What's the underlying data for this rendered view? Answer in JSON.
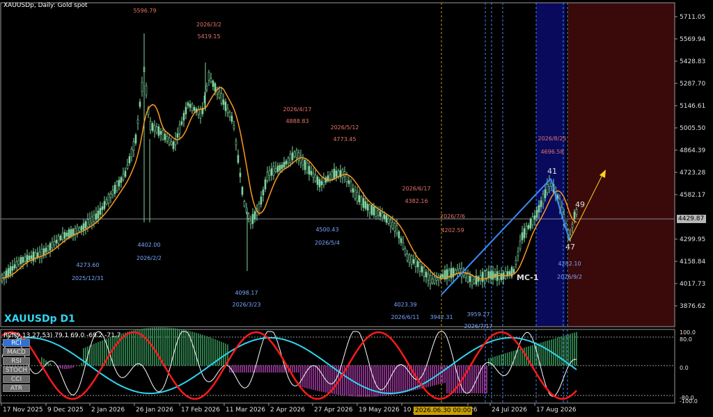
{
  "header": {
    "title": "XAUUSDp, Daily:  Gold spot"
  },
  "symbol_label": "XAUUSDp D1",
  "colors": {
    "background": "#000000",
    "bull": "#7fd6a0",
    "ma": "#ff9a1f",
    "annotation_high": "#e8756a",
    "annotation_low": "#7aa7ff",
    "trend": "#3a8dff",
    "projection": "#ffd21a",
    "zone_blue": "#0a0a5c",
    "zone_red": "#3a0a0a",
    "rci_fast": "#ffffff",
    "rci_mid": "#ff1a1a",
    "rci_slow": "#2fd6f0"
  },
  "price_axis": [
    "5711.05",
    "5569.94",
    "5428.83",
    "5287.70",
    "5146.61",
    "5005.50",
    "4864.39",
    "4723.28",
    "4582.17",
    "4429.87",
    "4299.95",
    "4158.84",
    "4017.73",
    "3876.62"
  ],
  "current_price": "4429.87",
  "date_axis": [
    "17 Nov 2025",
    "9 Dec 2025",
    "2 Jan 2026",
    "26 Jan 2026",
    "17 Feb 2026",
    "11 Mar 2026",
    "2 Apr 2026",
    "27 Apr 2026",
    "19 May 2026",
    "10 J",
    "26",
    "24 Jul 2026",
    "17 Aug 2026"
  ],
  "cursor_time": "2026.06.30 00:00",
  "annotations": [
    {
      "date": "",
      "price": "5596.79",
      "kind": "high"
    },
    {
      "date": "2026/3/2",
      "price": "5419.15",
      "kind": "high"
    },
    {
      "date": "2026/4/17",
      "price": "4888.83",
      "kind": "high"
    },
    {
      "date": "2026/5/12",
      "price": "4773.45",
      "kind": "high"
    },
    {
      "date": "2026/6/17",
      "price": "4382.16",
      "kind": "high"
    },
    {
      "date": "2026/7/6",
      "price": "4202.59",
      "kind": "high"
    },
    {
      "date": "2026/8/25",
      "price": "4696.58",
      "kind": "high"
    },
    {
      "date": "2025/12/31",
      "price": "4273.60",
      "kind": "low"
    },
    {
      "date": "2026/2/2",
      "price": "4402.00",
      "kind": "low"
    },
    {
      "date": "2026/3/23",
      "price": "4098.17",
      "kind": "low"
    },
    {
      "date": "2026/5/4",
      "price": "4500.43",
      "kind": "low"
    },
    {
      "date": "2026/6/11",
      "price": "4023.39",
      "kind": "low"
    },
    {
      "date": "",
      "price": "3942.31",
      "kind": "low"
    },
    {
      "date": "2026/7/17",
      "price": "3959.27",
      "kind": "low"
    },
    {
      "date": "2026/9/2",
      "price": "4282.10",
      "kind": "low"
    }
  ],
  "wave_labels": {
    "peak": "41",
    "next": "49",
    "low": "47",
    "mc": "MC-1"
  },
  "rci": {
    "header": "RCI(9,13,27,53) 79.1 69.0 -69.2 -71.7",
    "axis": [
      "100.0",
      "80.0",
      "0.0",
      "-80.0",
      "-100.0"
    ]
  },
  "indicator_buttons": [
    {
      "label": "RCI",
      "active": true
    },
    {
      "label": "MACD",
      "active": false
    },
    {
      "label": "RSI",
      "active": false
    },
    {
      "label": "STOCH",
      "active": false
    },
    {
      "label": "CCI",
      "active": false
    },
    {
      "label": "ATR",
      "active": false
    }
  ]
}
